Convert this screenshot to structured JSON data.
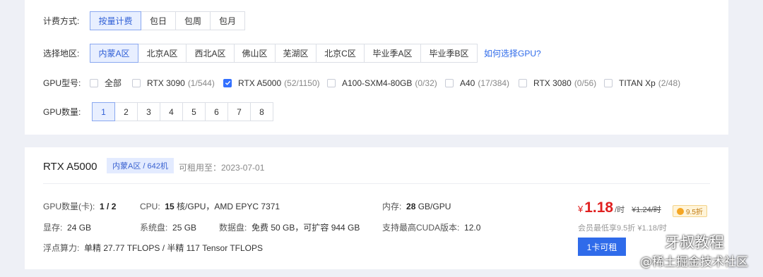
{
  "filters": {
    "billing": {
      "label": "计费方式:",
      "options": [
        "按量计费",
        "包日",
        "包周",
        "包月"
      ],
      "selected": "按量计费"
    },
    "region": {
      "label": "选择地区:",
      "options": [
        "内蒙A区",
        "北京A区",
        "西北A区",
        "佛山区",
        "芜湖区",
        "北京C区",
        "毕业季A区",
        "毕业季B区"
      ],
      "selected": "内蒙A区",
      "help_link": "如何选择GPU?"
    },
    "gpu_model": {
      "label": "GPU型号:",
      "options": [
        {
          "name": "全部",
          "count": "",
          "checked": false
        },
        {
          "name": "RTX 3090",
          "count": "(1/544)",
          "checked": false
        },
        {
          "name": "RTX A5000",
          "count": "(52/1150)",
          "checked": true
        },
        {
          "name": "A100-SXM4-80GB",
          "count": "(0/32)",
          "checked": false
        },
        {
          "name": "A40",
          "count": "(17/384)",
          "checked": false
        },
        {
          "name": "RTX 3080",
          "count": "(0/56)",
          "checked": false
        },
        {
          "name": "TITAN Xp",
          "count": "(2/48)",
          "checked": false
        }
      ]
    },
    "gpu_count": {
      "label": "GPU数量:",
      "options": [
        "1",
        "2",
        "3",
        "4",
        "5",
        "6",
        "7",
        "8"
      ],
      "selected": "1"
    }
  },
  "product": {
    "title": "RTX A5000",
    "region_badge": "内蒙A区 / 642机",
    "available_until": "可租用至：2023-07-01",
    "specs": {
      "gpu_count_label": "GPU数量(卡):",
      "gpu_count_value": "1 / 2",
      "cpu_label": "CPU:",
      "cpu_bold": "15",
      "cpu_rest": "核/GPU，AMD EPYC 7371",
      "mem_label": "内存:",
      "mem_bold": "28",
      "mem_rest": "GB/GPU",
      "vram_label": "显存:",
      "vram_value": "24 GB",
      "sysdisk_label": "系统盘:",
      "sysdisk_value": "25 GB",
      "datadisk_label": "数据盘:",
      "datadisk_value": "免费 50 GB，可扩容 944 GB",
      "cuda_label": "支持最高CUDA版本:",
      "cuda_value": "12.0",
      "flops_label": "浮点算力:",
      "flops_value": "单精 27.77 TFLOPS / 半精 117 Tensor TFLOPS"
    },
    "price": {
      "currency": "¥",
      "value": "1.18",
      "unit": "/时",
      "original": "¥1.24/时",
      "discount": "9.5折",
      "member_note": "会员最低享9.5折 ¥1.18/时"
    },
    "rent_button": "1卡可租"
  },
  "watermark": {
    "line1": "牙叔教程",
    "line2": "@稀土掘金技术社区"
  }
}
